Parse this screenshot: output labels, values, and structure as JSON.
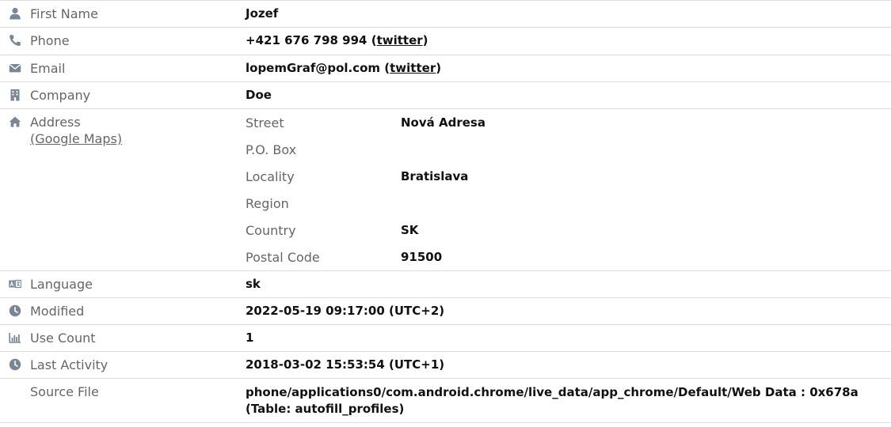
{
  "rows": {
    "first_name": {
      "label": "First Name",
      "value": "Jozef",
      "icon": "user-icon"
    },
    "phone": {
      "label": "Phone",
      "value": "+421 676 798 994",
      "link_text": "twitter",
      "icon": "phone-icon"
    },
    "email": {
      "label": "Email",
      "value": "lopemGraf@pol.com",
      "link_text": "twitter",
      "icon": "envelope-icon"
    },
    "company": {
      "label": "Company",
      "value": "Doe",
      "icon": "building-icon"
    },
    "address": {
      "label": "Address",
      "maps_link": "(Google Maps)",
      "icon": "home-icon",
      "fields": [
        {
          "label": "Street",
          "value": "Nová Adresa"
        },
        {
          "label": "P.O. Box",
          "value": ""
        },
        {
          "label": "Locality",
          "value": "Bratislava"
        },
        {
          "label": "Region",
          "value": ""
        },
        {
          "label": "Country",
          "value": "SK"
        },
        {
          "label": "Postal Code",
          "value": "91500"
        }
      ]
    },
    "language": {
      "label": "Language",
      "value": "sk",
      "icon": "language-icon"
    },
    "modified": {
      "label": "Modified",
      "value": "2022-05-19 09:17:00 (UTC+2)",
      "icon": "clock-icon"
    },
    "use_count": {
      "label": "Use Count",
      "value": "1",
      "icon": "bar-chart-icon"
    },
    "last_activity": {
      "label": "Last Activity",
      "value": "2018-03-02 15:53:54 (UTC+1)",
      "icon": "clock-icon"
    },
    "source_file": {
      "label": "Source File",
      "value": "phone/applications0/com.android.chrome/live_data/app_chrome/Default/Web Data : 0x678a (Table: autofill_profiles)"
    }
  },
  "colors": {
    "icon": "#7a8694",
    "label": "#666666",
    "value": "#111111",
    "border": "#dcdcdc"
  }
}
